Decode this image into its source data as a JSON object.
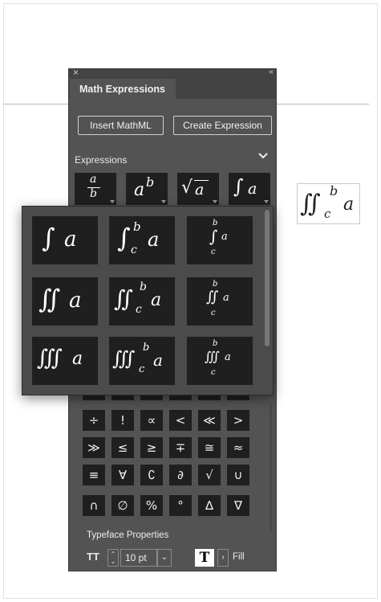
{
  "panel": {
    "title": "Math Expressions",
    "buttons": {
      "insert_mathml": "Insert MathML",
      "create_expression": "Create Expression"
    },
    "section_label": "Expressions",
    "templates": [
      {
        "icon": "fraction-icon",
        "num": "a",
        "den": "b"
      },
      {
        "icon": "superscript-icon",
        "base": "a",
        "sup": "b"
      },
      {
        "icon": "square-root-icon",
        "radical": "√",
        "arg": "a"
      },
      {
        "icon": "integral-icon",
        "sym": "∫",
        "arg": "a"
      }
    ],
    "symbols_row1": [
      "÷",
      "!",
      "∝",
      "<",
      "≪",
      ">"
    ],
    "symbols_row2": [
      "≫",
      "≤",
      "≥",
      "∓",
      "≅",
      "≈"
    ],
    "symbols_row3": [
      "≡",
      "∀",
      "∁",
      "∂",
      "√",
      "∪"
    ],
    "symbols_row4": [
      "∩",
      "∅",
      "%",
      "°",
      "∆",
      "∇"
    ],
    "typeface": {
      "label": "Typeface Properties",
      "size_value": "10 pt",
      "fill_glyph": "T",
      "fill_label": "Fill"
    },
    "icons": {
      "close": "×",
      "collapse": "‹‹",
      "chevron_down": "chevron-down-icon",
      "stepper_up": "⌃",
      "stepper_down": "⌄",
      "dropdown": "⌄",
      "fill_chevron": "›"
    }
  },
  "popup": {
    "integral_sym": [
      "∫",
      "∬",
      "∭"
    ],
    "arg": "a",
    "upper": "b",
    "lower": "c"
  },
  "canvas": {
    "selected_expression": {
      "sym": "∬",
      "lower": "c",
      "upper": "b",
      "arg": "a"
    }
  }
}
